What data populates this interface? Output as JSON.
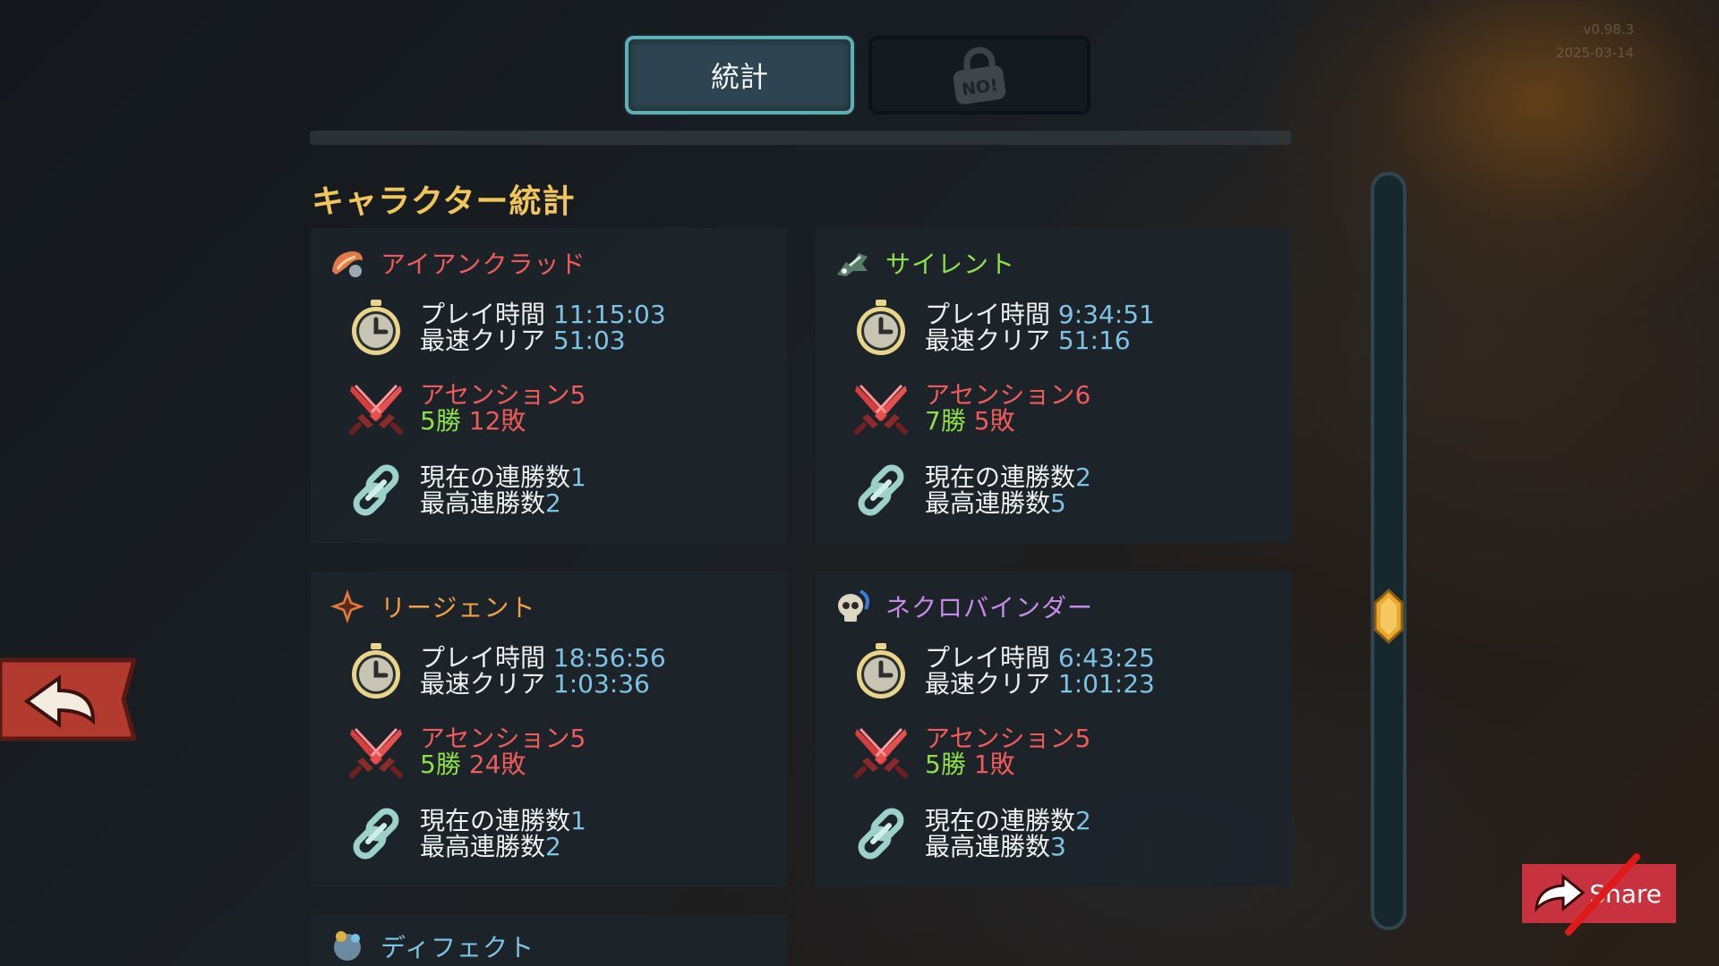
{
  "version": {
    "build": "v0.98.3",
    "date": "2025-03-14"
  },
  "tabs": [
    {
      "label": "統計",
      "active": true
    },
    {
      "label": "",
      "active": false,
      "icon": "lock-no-icon"
    }
  ],
  "section_title": "キャラクター統計",
  "labels": {
    "play_time": "プレイ時間",
    "fastest_clear": "最速クリア",
    "ascension": "アセンション",
    "wins": "勝",
    "losses": "敗",
    "current_streak": "現在の連勝数",
    "best_streak": "最高連勝数"
  },
  "characters": [
    {
      "name": "アイアンクラッド",
      "name_color": "#ef5b5b",
      "icon": "ironclad-icon",
      "play_time": "11:15:03",
      "fastest_clear": "51:03",
      "ascension": "5",
      "wins": "5",
      "losses": "12",
      "current_streak": "1",
      "best_streak": "2"
    },
    {
      "name": "サイレント",
      "name_color": "#8ee04a",
      "icon": "silent-icon",
      "play_time": "9:34:51",
      "fastest_clear": "51:16",
      "ascension": "6",
      "wins": "7",
      "losses": "5",
      "current_streak": "2",
      "best_streak": "5"
    },
    {
      "name": "リージェント",
      "name_color": "#f0a040",
      "icon": "regent-icon",
      "play_time": "18:56:56",
      "fastest_clear": "1:03:36",
      "ascension": "5",
      "wins": "5",
      "losses": "24",
      "current_streak": "1",
      "best_streak": "2"
    },
    {
      "name": "ネクロバインダー",
      "name_color": "#c88ae8",
      "icon": "necrobinder-icon",
      "play_time": "6:43:25",
      "fastest_clear": "1:01:23",
      "ascension": "5",
      "wins": "5",
      "losses": "1",
      "current_streak": "2",
      "best_streak": "3"
    },
    {
      "name": "ディフェクト",
      "name_color": "#7ec3e6",
      "icon": "defect-icon"
    }
  ],
  "share": {
    "label": "Share"
  },
  "colors": {
    "tab_border": "#5fb0b5",
    "title": "#f0c55a",
    "stat_value": "#7ec3e6",
    "ascension": "#ef5b5b",
    "wins": "#8ee04a",
    "losses": "#ef5b5b",
    "share_bg": "#c8323e"
  }
}
